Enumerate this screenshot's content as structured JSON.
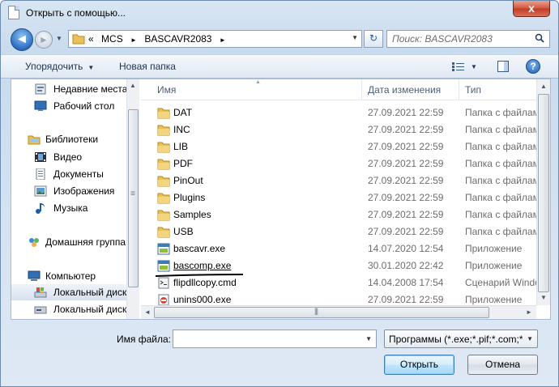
{
  "window": {
    "title": "Открыть с помощью...",
    "close_label": "x"
  },
  "nav": {
    "back_glyph": "◄",
    "forward_glyph": "►",
    "crumbs": [
      "«",
      "MCS",
      "►",
      "BASCAVR2083",
      "►"
    ],
    "search_placeholder": "Поиск: BASCAVR2083"
  },
  "toolbar": {
    "organize_label": "Упорядочить",
    "new_folder_label": "Новая папка",
    "help_label": "?"
  },
  "navpane": {
    "items": [
      {
        "label": "Недавние места",
        "icon": "recent-places-icon"
      },
      {
        "label": "Рабочий стол",
        "icon": "desktop-icon"
      },
      {
        "label": "Библиотеки",
        "icon": "libraries-icon"
      },
      {
        "label": "Видео",
        "icon": "video-icon"
      },
      {
        "label": "Документы",
        "icon": "documents-icon"
      },
      {
        "label": "Изображения",
        "icon": "pictures-icon"
      },
      {
        "label": "Музыка",
        "icon": "music-icon"
      },
      {
        "label": "Домашняя группа",
        "icon": "homegroup-icon"
      },
      {
        "label": "Компьютер",
        "icon": "computer-icon"
      },
      {
        "label": "Локальный диск",
        "icon": "local-disk-icon"
      },
      {
        "label": "Локальный диск",
        "icon": "local-disk-icon"
      }
    ]
  },
  "filepane": {
    "columns": {
      "name": "Имя",
      "date": "Дата изменения",
      "type": "Тип"
    },
    "rows": [
      {
        "name": "DAT",
        "date": "27.09.2021 22:59",
        "type": "Папка с файлами",
        "icon": "folder-icon"
      },
      {
        "name": "INC",
        "date": "27.09.2021 22:59",
        "type": "Папка с файлами",
        "icon": "folder-icon"
      },
      {
        "name": "LIB",
        "date": "27.09.2021 22:59",
        "type": "Папка с файлами",
        "icon": "folder-icon"
      },
      {
        "name": "PDF",
        "date": "27.09.2021 22:59",
        "type": "Папка с файлами",
        "icon": "folder-icon"
      },
      {
        "name": "PinOut",
        "date": "27.09.2021 22:59",
        "type": "Папка с файлами",
        "icon": "folder-icon"
      },
      {
        "name": "Plugins",
        "date": "27.09.2021 22:59",
        "type": "Папка с файлами",
        "icon": "folder-icon"
      },
      {
        "name": "Samples",
        "date": "27.09.2021 22:59",
        "type": "Папка с файлами",
        "icon": "folder-icon"
      },
      {
        "name": "USB",
        "date": "27.09.2021 22:59",
        "type": "Папка с файлами",
        "icon": "folder-icon"
      },
      {
        "name": "bascavr.exe",
        "date": "14.07.2020 12:54",
        "type": "Приложение",
        "icon": "application-icon"
      },
      {
        "name": "bascomp.exe",
        "date": "30.01.2020 22:42",
        "type": "Приложение",
        "icon": "application-icon"
      },
      {
        "name": "flipdllcopy.cmd",
        "date": "14.04.2008 17:54",
        "type": "Сценарий Windows",
        "icon": "script-icon"
      },
      {
        "name": "unins000.exe",
        "date": "27.09.2021 22:59",
        "type": "Приложение",
        "icon": "uninstaller-icon"
      }
    ]
  },
  "bottom": {
    "filename_label": "Имя файла:",
    "filename_value": "",
    "filter_value": "Программы (*.exe;*.pif;*.com;*.bat;*.cmd)",
    "open_label": "Открыть",
    "cancel_label": "Отмена"
  },
  "colors": {
    "accent": "#2b6fc1",
    "folder": "#e8c15a",
    "close": "#c13a22"
  }
}
